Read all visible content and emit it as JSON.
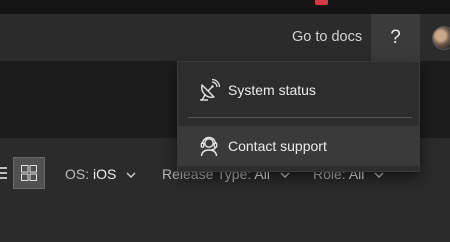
{
  "header": {
    "docs_link": "Go to docs",
    "help_symbol": "?",
    "avatar_label": "user avatar"
  },
  "toolbar": {
    "filters": [
      {
        "name": "OS: ",
        "value": "iOS"
      },
      {
        "name": "Release Type: ",
        "value": "All"
      },
      {
        "name": "Role: ",
        "value": "All"
      }
    ]
  },
  "help_menu": {
    "items": [
      {
        "label": "System status",
        "icon": "satellite-dish-icon"
      },
      {
        "label": "Contact support",
        "icon": "headset-icon"
      }
    ]
  },
  "colors": {
    "header_bg": "#2b2b2b",
    "page_bg": "#1c1c1c",
    "menu_bg": "#2d2d2d",
    "hover_bg": "#3a3a3a",
    "accent": "#4a90d9",
    "notification": "#d23a45"
  }
}
